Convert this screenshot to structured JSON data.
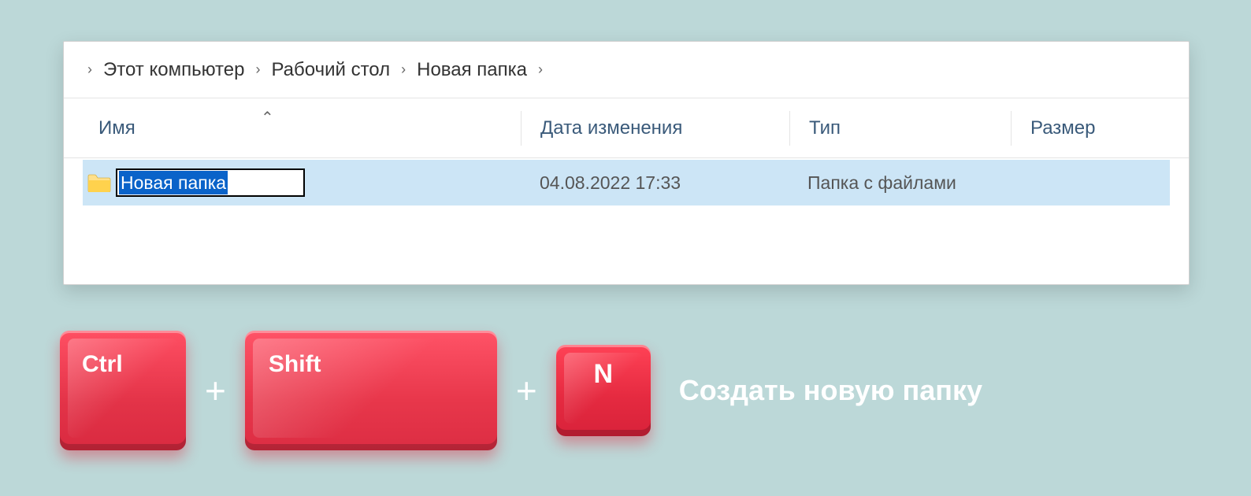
{
  "breadcrumb": {
    "items": [
      "Этот компьютер",
      "Рабочий стол",
      "Новая папка"
    ]
  },
  "columns": {
    "name": "Имя",
    "date": "Дата изменения",
    "type": "Тип",
    "size": "Размер"
  },
  "row": {
    "name_editing": "Новая папка",
    "date": "04.08.2022 17:33",
    "type": "Папка с файлами",
    "size": ""
  },
  "shortcut": {
    "keys": {
      "ctrl": "Ctrl",
      "shift": "Shift",
      "n": "N"
    },
    "plus": "+",
    "label": "Создать новую папку"
  }
}
